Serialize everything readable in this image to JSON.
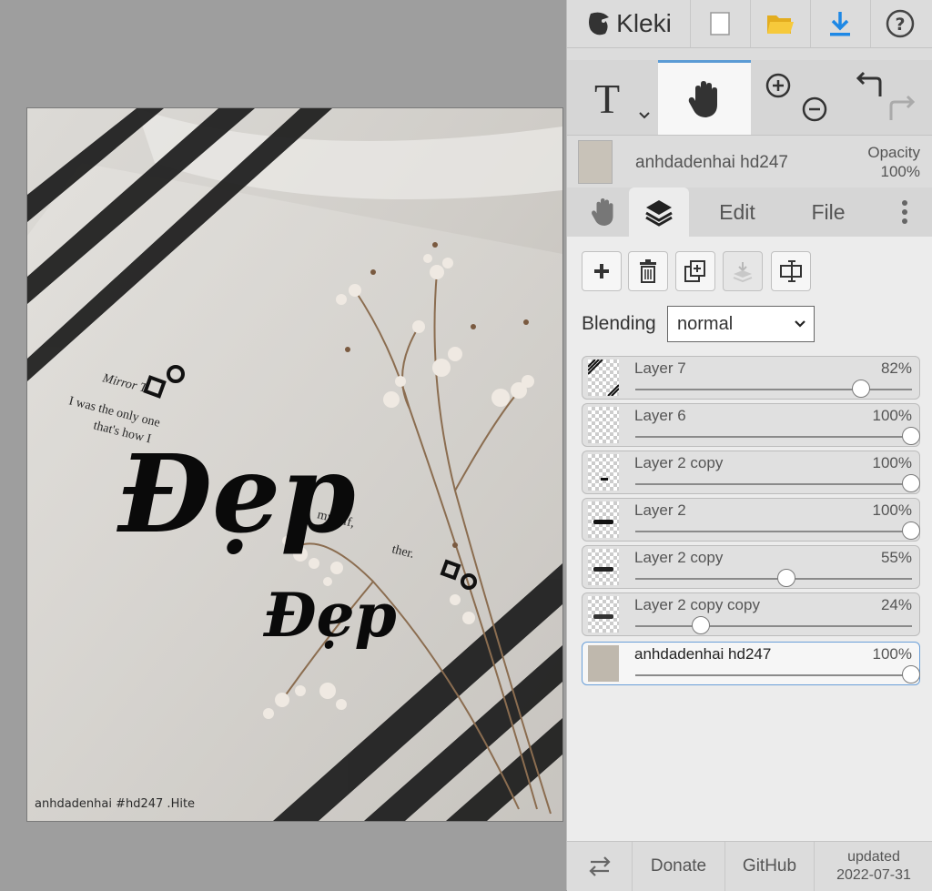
{
  "app": {
    "logo_text": "Kleki"
  },
  "canvas": {
    "watermark": "anhdadenhai #hd247 .Hite",
    "title_text": "Đẹp",
    "subtitle_text": "Đẹp",
    "book_lines": [
      "Mirror T",
      "I was the only one",
      "that's how I",
      "myself,",
      "ther."
    ]
  },
  "current_layer": {
    "name": "anhdadenhai hd247",
    "opacity_label": "Opacity",
    "opacity_value": "100%"
  },
  "tabs": {
    "edit": "Edit",
    "file": "File"
  },
  "blending": {
    "label": "Blending",
    "value": "normal"
  },
  "layers": [
    {
      "name": "Layer 7",
      "opacity": "82%",
      "value": 0.82
    },
    {
      "name": "Layer 6",
      "opacity": "100%",
      "value": 1.0
    },
    {
      "name": "Layer 2 copy",
      "opacity": "100%",
      "value": 1.0
    },
    {
      "name": "Layer 2",
      "opacity": "100%",
      "value": 1.0
    },
    {
      "name": "Layer 2 copy",
      "opacity": "55%",
      "value": 0.55
    },
    {
      "name": "Layer 2 copy copy",
      "opacity": "24%",
      "value": 0.24
    },
    {
      "name": "anhdadenhai hd247",
      "opacity": "100%",
      "value": 1.0
    }
  ],
  "bottom": {
    "donate": "Donate",
    "github": "GitHub",
    "updated_label": "updated",
    "updated_date": "2022-07-31"
  },
  "colors": {
    "accent": "#5b9bd5",
    "folder": "#f2c12e",
    "download": "#1e88e5"
  },
  "icons": {
    "topbar": [
      "new-file-icon",
      "open-folder-icon",
      "download-icon",
      "help-icon"
    ],
    "tools": [
      "text-tool-icon",
      "hand-tool-icon",
      "zoom-in-icon",
      "zoom-out-icon",
      "undo-icon",
      "redo-icon"
    ],
    "layer_actions": [
      "add-layer-icon",
      "delete-layer-icon",
      "duplicate-layer-icon",
      "merge-down-icon",
      "rename-layer-icon"
    ]
  }
}
